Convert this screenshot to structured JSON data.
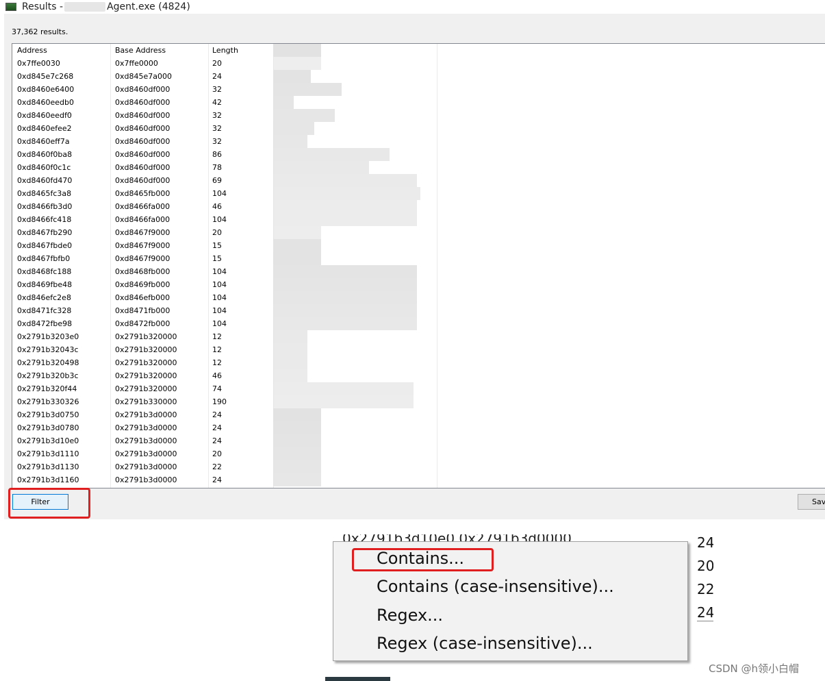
{
  "window": {
    "title_prefix": "Results -",
    "title_suffix": "Agent.exe (4824)"
  },
  "results_count": "37,362 results.",
  "columns": [
    "Address",
    "Base Address",
    "Length"
  ],
  "rows": [
    [
      "0x7ffe0030",
      "0x7ffe0000",
      "20"
    ],
    [
      "0xd845e7c268",
      "0xd845e7a000",
      "24"
    ],
    [
      "0xd8460e6400",
      "0xd8460df000",
      "32"
    ],
    [
      "0xd8460eedb0",
      "0xd8460df000",
      "42"
    ],
    [
      "0xd8460eedf0",
      "0xd8460df000",
      "32"
    ],
    [
      "0xd8460efee2",
      "0xd8460df000",
      "32"
    ],
    [
      "0xd8460eff7a",
      "0xd8460df000",
      "32"
    ],
    [
      "0xd8460f0ba8",
      "0xd8460df000",
      "86"
    ],
    [
      "0xd8460f0c1c",
      "0xd8460df000",
      "78"
    ],
    [
      "0xd8460fd470",
      "0xd8460df000",
      "69"
    ],
    [
      "0xd8465fc3a8",
      "0xd8465fb000",
      "104"
    ],
    [
      "0xd8466fb3d0",
      "0xd8466fa000",
      "46"
    ],
    [
      "0xd8466fc418",
      "0xd8466fa000",
      "104"
    ],
    [
      "0xd8467fb290",
      "0xd8467f9000",
      "20"
    ],
    [
      "0xd8467fbde0",
      "0xd8467f9000",
      "15"
    ],
    [
      "0xd8467fbfb0",
      "0xd8467f9000",
      "15"
    ],
    [
      "0xd8468fc188",
      "0xd8468fb000",
      "104"
    ],
    [
      "0xd8469fbe48",
      "0xd8469fb000",
      "104"
    ],
    [
      "0xd846efc2e8",
      "0xd846efb000",
      "104"
    ],
    [
      "0xd8471fc328",
      "0xd8471fb000",
      "104"
    ],
    [
      "0xd8472fbe98",
      "0xd8472fb000",
      "104"
    ],
    [
      "0x2791b3203e0",
      "0x2791b320000",
      "12"
    ],
    [
      "0x2791b32043c",
      "0x2791b320000",
      "12"
    ],
    [
      "0x2791b320498",
      "0x2791b320000",
      "12"
    ],
    [
      "0x2791b320b3c",
      "0x2791b320000",
      "46"
    ],
    [
      "0x2791b320f44",
      "0x2791b320000",
      "74"
    ],
    [
      "0x2791b330326",
      "0x2791b330000",
      "190"
    ],
    [
      "0x2791b3d0750",
      "0x2791b3d0000",
      "24"
    ],
    [
      "0x2791b3d0780",
      "0x2791b3d0000",
      "24"
    ],
    [
      "0x2791b3d10e0",
      "0x2791b3d0000",
      "24"
    ],
    [
      "0x2791b3d1110",
      "0x2791b3d0000",
      "20"
    ],
    [
      "0x2791b3d1130",
      "0x2791b3d0000",
      "22"
    ],
    [
      "0x2791b3d1160",
      "0x2791b3d0000",
      "24"
    ]
  ],
  "buttons": {
    "filter": "Filter",
    "save": "Sav"
  },
  "context_menu": {
    "partial_row": "0x2791b3d10e0        0x2791b3d0000",
    "items": [
      "Contains...",
      "Contains (case-insensitive)...",
      "Regex...",
      "Regex (case-insensitive)..."
    ],
    "side_lengths": [
      "24",
      "20",
      "22",
      "24"
    ]
  },
  "watermark": "CSDN @h领小白帽",
  "colors": {
    "highlight": "#e02020",
    "focus": "#0078d7"
  }
}
